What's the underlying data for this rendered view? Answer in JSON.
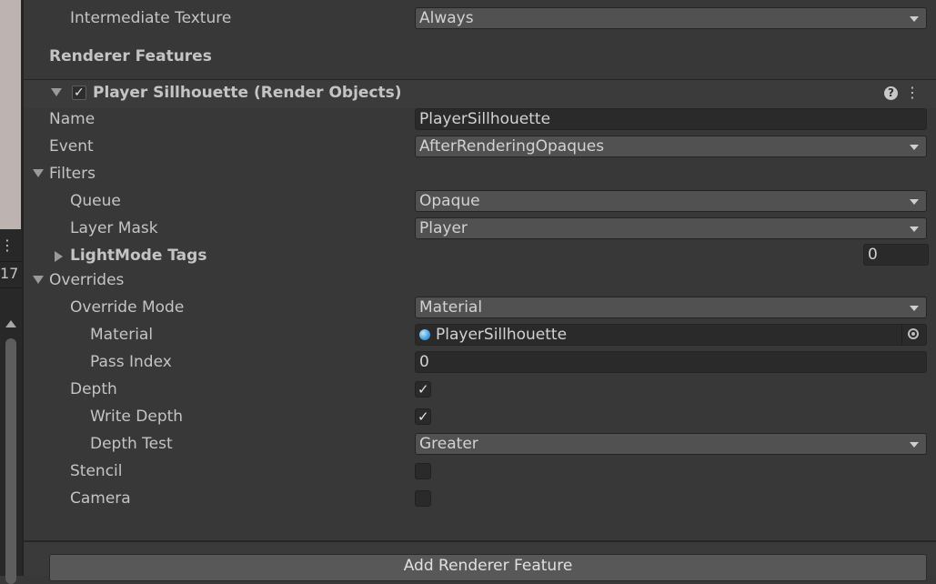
{
  "top": {
    "intermediate_texture_label": "Intermediate Texture",
    "intermediate_texture_value": "Always"
  },
  "renderer_features_heading": "Renderer Features",
  "feature": {
    "title": "Player Sillhouette (Render Objects)",
    "name_label": "Name",
    "name_value": "PlayerSillhouette",
    "event_label": "Event",
    "event_value": "AfterRenderingOpaques",
    "filters": {
      "label": "Filters",
      "queue_label": "Queue",
      "queue_value": "Opaque",
      "layer_mask_label": "Layer Mask",
      "layer_mask_value": "Player",
      "lightmode_label": "LightMode Tags",
      "lightmode_count": "0"
    },
    "overrides": {
      "label": "Overrides",
      "override_mode_label": "Override Mode",
      "override_mode_value": "Material",
      "material_label": "Material",
      "material_value": "PlayerSillhouette",
      "pass_index_label": "Pass Index",
      "pass_index_value": "0",
      "depth_label": "Depth",
      "depth_checked": true,
      "write_depth_label": "Write Depth",
      "write_depth_checked": true,
      "depth_test_label": "Depth Test",
      "depth_test_value": "Greater",
      "stencil_label": "Stencil",
      "stencil_checked": false,
      "camera_label": "Camera",
      "camera_checked": false
    }
  },
  "left_strip": {
    "menu_glyph": "⋮",
    "number": "17"
  },
  "add_button_label": "Add Renderer Feature",
  "icons": {
    "checkmark": "✓",
    "help": "?",
    "menu": "⋮"
  }
}
